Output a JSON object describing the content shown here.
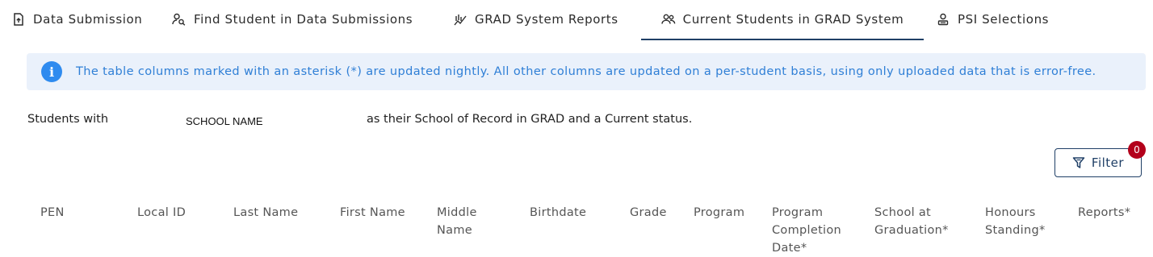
{
  "tabs": [
    {
      "label": "Data Submission",
      "icon": "upload-file-icon"
    },
    {
      "label": "Find Student in Data Submissions",
      "icon": "person-search-icon"
    },
    {
      "label": "GRAD System Reports",
      "icon": "reports-chart-icon"
    },
    {
      "label": "Current Students in GRAD System",
      "icon": "group-icon",
      "active": true
    },
    {
      "label": "PSI Selections",
      "icon": "person-badge-icon"
    }
  ],
  "alert": {
    "icon": "info-icon",
    "message": "The table columns marked with an asterisk (*) are updated nightly. All other columns are updated on a per-student basis, using only uploaded data that is error-free."
  },
  "school_line": {
    "prefix": "Students with",
    "school_name": "SCHOOL NAME",
    "suffix": "as their School of Record in GRAD and a Current status."
  },
  "filter": {
    "label": "Filter",
    "icon": "filter-icon",
    "badge_count": "0"
  },
  "table": {
    "headers": [
      "PEN",
      "Local ID",
      "Last Name",
      "First Name",
      "Middle\nName",
      "Birthdate",
      "Grade",
      "Program",
      "Program\nCompletion\nDate*",
      "School at\nGraduation*",
      "Honours\nStanding*",
      "Reports*"
    ]
  },
  "colors": {
    "accent": "#1f3f66",
    "info_bg": "#eaf1fb",
    "info_text": "#2f7fd6",
    "badge": "#b3001b"
  }
}
